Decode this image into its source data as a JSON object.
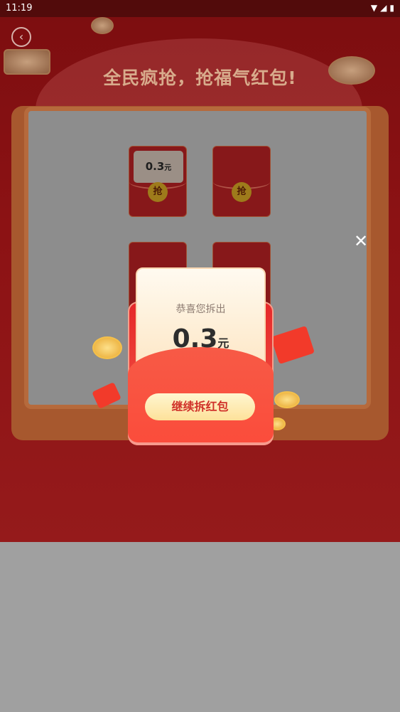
{
  "status_bar": {
    "time": "11:19"
  },
  "header": {
    "title": "全民疯抢，抢福气红包!"
  },
  "board": {
    "grab_label": "抢",
    "opened_amount": "0.3",
    "opened_unit": "元"
  },
  "popup": {
    "congrats": "恭喜您拆出",
    "amount": "0.3",
    "unit": "元",
    "continue_label": "继续拆红包"
  }
}
